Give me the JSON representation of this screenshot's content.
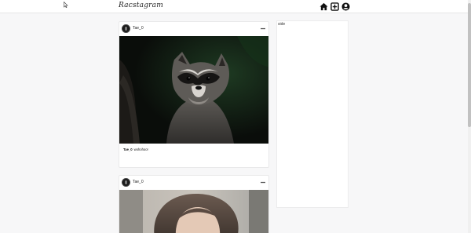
{
  "app": {
    "title": "Racstagram"
  },
  "nav": {
    "icons": [
      "home-icon",
      "add-post-icon",
      "profile-icon"
    ]
  },
  "posts": [
    {
      "username": "Tae_0",
      "caption_user": "Tae_0",
      "caption_text": "wohohoo!"
    },
    {
      "username": "Tae_0"
    }
  ],
  "side": {
    "label": "side"
  },
  "colors": {
    "background": "#f7f7f8",
    "card": "#ffffff",
    "border": "#e9e9ea"
  }
}
